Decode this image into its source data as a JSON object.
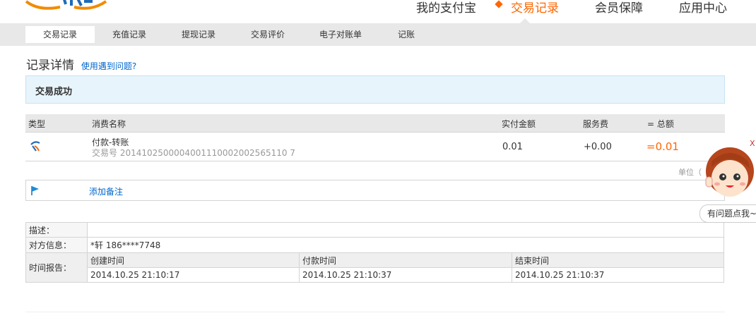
{
  "nav": {
    "items": [
      {
        "label": "我的支付宝"
      },
      {
        "label": "交易记录"
      },
      {
        "label": "会员保障"
      },
      {
        "label": "应用中心"
      }
    ]
  },
  "subnav": {
    "tabs": [
      {
        "label": "交易记录"
      },
      {
        "label": "充值记录"
      },
      {
        "label": "提现记录"
      },
      {
        "label": "交易评价"
      },
      {
        "label": "电子对账单"
      },
      {
        "label": "记账"
      }
    ]
  },
  "page": {
    "title": "记录详情",
    "help_link": "使用遇到问题?"
  },
  "status": {
    "text": "交易成功"
  },
  "table": {
    "headers": {
      "type": "类型",
      "name": "消费名称",
      "amount": "实付金额",
      "fee": "服务费",
      "total": "= 总额"
    },
    "row": {
      "name": "付款-转账",
      "trade_no": "交易号 2014102500004001110002002565110 7",
      "amount": "0.01",
      "fee": "+0.00",
      "total": "=0.01"
    }
  },
  "unit_label": "单位（",
  "note": {
    "label": "添加备注"
  },
  "info": {
    "desc_label": "描述：",
    "desc_value": "",
    "counterparty_label": "对方信息：",
    "counterparty_value": "*轩 186****7748",
    "time_label": "时间报告：",
    "time_headers": {
      "created": "创建时间",
      "paid": "付款时间",
      "finished": "结束时间"
    },
    "time_values": {
      "created": "2014.10.25 21:10:17",
      "paid": "2014.10.25 21:10:37",
      "finished": "2014.10.25 21:10:37"
    }
  },
  "assistant": {
    "bubble": "有问题点我~",
    "close": "X"
  },
  "colors": {
    "accent": "#ff6600",
    "link": "#0066cc",
    "status_bg": "#e8f4fb"
  }
}
